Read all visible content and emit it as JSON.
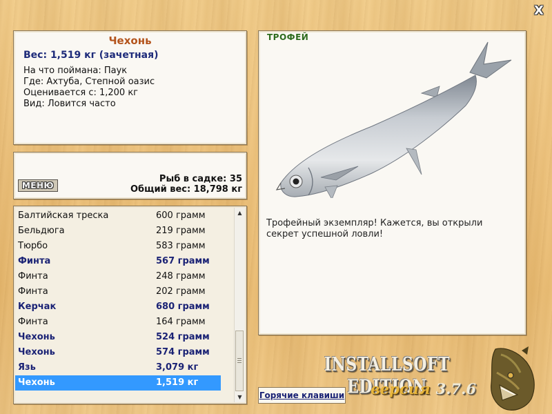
{
  "fish": {
    "name": "Чехонь",
    "weight_line": "Вес: 1,519 кг (зачетная)",
    "details": [
      "На что поймана: Паук",
      "Где: Ахтуба, Степной оазис",
      "Оценивается с: 1,200 кг",
      "Вид: Ловится часто"
    ]
  },
  "stats": {
    "menu_label": "МЕНЮ",
    "fish_count": "Рыб в садке: 35",
    "total_weight": "Общий вес: 18,798 кг"
  },
  "catch_list": {
    "rows": [
      {
        "name": "Балтийская треска",
        "weight": "600 грамм",
        "highlight": false,
        "selected": false
      },
      {
        "name": "Бельдюга",
        "weight": "219 грамм",
        "highlight": false,
        "selected": false
      },
      {
        "name": "Тюрбо",
        "weight": "583 грамм",
        "highlight": false,
        "selected": false
      },
      {
        "name": "Финта",
        "weight": "567 грамм",
        "highlight": true,
        "selected": false
      },
      {
        "name": "Финта",
        "weight": "248 грамм",
        "highlight": false,
        "selected": false
      },
      {
        "name": "Финта",
        "weight": "202 грамм",
        "highlight": false,
        "selected": false
      },
      {
        "name": "Керчак",
        "weight": "680 грамм",
        "highlight": true,
        "selected": false
      },
      {
        "name": "Финта",
        "weight": "164 грамм",
        "highlight": false,
        "selected": false
      },
      {
        "name": "Чехонь",
        "weight": "524 грамм",
        "highlight": true,
        "selected": false
      },
      {
        "name": "Чехонь",
        "weight": "574 грамм",
        "highlight": true,
        "selected": false
      },
      {
        "name": "Язь",
        "weight": "3,079 кг",
        "highlight": true,
        "selected": false
      },
      {
        "name": "Чехонь",
        "weight": "1,519 кг",
        "highlight": true,
        "selected": true
      }
    ],
    "scroll_up_icon": "triangle-up",
    "scroll_down_icon": "triangle-down"
  },
  "trophy": {
    "label": "ТРОФЕЙ",
    "text": "Трофейный экземпляр! Кажется, вы открыли секрет успешной ловли!"
  },
  "hotkeys_label": "Горячие клавиши",
  "branding": {
    "edition": "INSTALLSOFT EDITION",
    "version_word": "версия",
    "version_number": "3.7.6"
  },
  "close_label": "X",
  "colors": {
    "title": "#b4541c",
    "bold_entry": "#1b2375",
    "selected_row": "#3399ff",
    "trophy_label": "#2d6b1d"
  }
}
